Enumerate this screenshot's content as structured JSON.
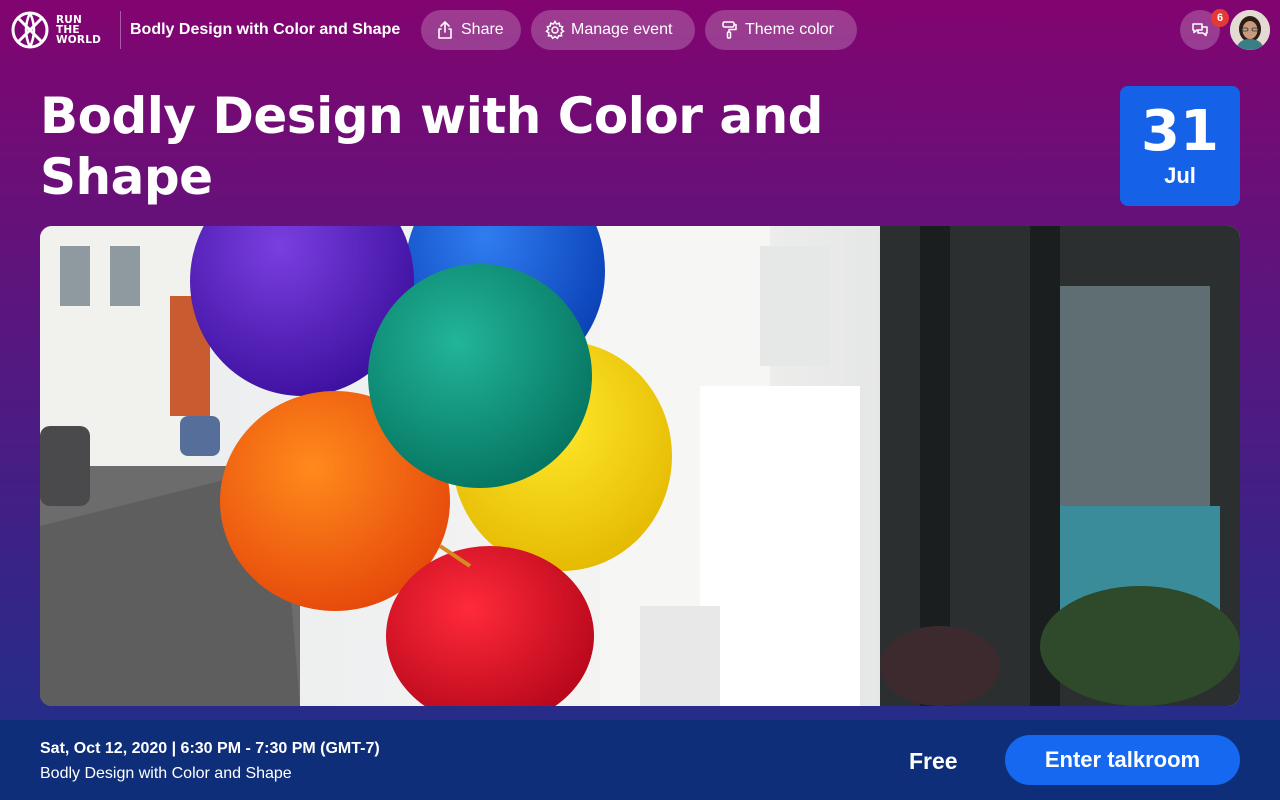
{
  "brand": {
    "logo_lines": [
      "RUN",
      "THE",
      "WORLD"
    ]
  },
  "header": {
    "event_name": "Bodly Design with Color and Shape",
    "buttons": {
      "share": {
        "label": "Share",
        "icon": "share-icon"
      },
      "manage": {
        "label": "Manage event",
        "icon": "gear-icon"
      },
      "theme": {
        "label": "Theme color",
        "icon": "paint-roller-icon"
      }
    },
    "chat": {
      "icon": "chat-bubbles-icon",
      "badge_count": "6"
    },
    "avatar": {
      "icon": "user-avatar"
    }
  },
  "event": {
    "title": "Bodly Design with Color and Shape",
    "date_day": "31",
    "date_month": "Jul",
    "banner": "colorful balloons on a city street"
  },
  "footer": {
    "datetime": "Sat, Oct 12, 2020 | 6:30 PM - 7:30 PM (GMT-7)",
    "subtitle": "Bodly Design with Color and Shape",
    "price": "Free",
    "cta_label": "Enter talkroom"
  },
  "colors": {
    "accent_blue": "#1668f0",
    "footer_bg": "#0f2e79",
    "gradient_top": "#820470",
    "gradient_bottom": "#1e3289",
    "badge_red": "#e53935"
  }
}
